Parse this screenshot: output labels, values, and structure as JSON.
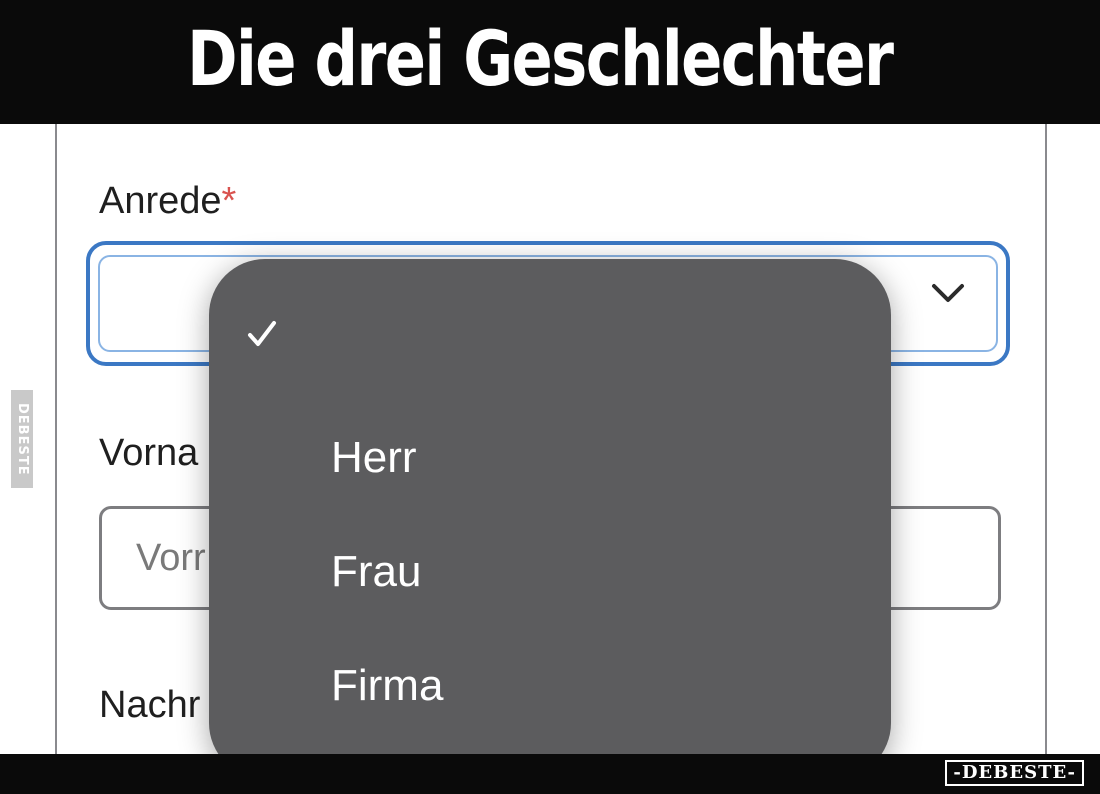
{
  "meme_title": "Die drei Geschlechter",
  "form": {
    "salutation": {
      "label": "Anrede",
      "required_marker": "*",
      "selected_value": ""
    },
    "first_name": {
      "label": "Vorna",
      "placeholder": "Vorr"
    },
    "last_name": {
      "label": "Nachr"
    }
  },
  "dropdown": {
    "options": [
      "",
      "Herr",
      "Frau",
      "Firma"
    ],
    "selected_index": 0
  },
  "watermark": {
    "side": "DEBESTE",
    "bottom": "-DEBESTE-"
  },
  "icons": {
    "select_chevron": "chevron-down-icon",
    "selected_marker": "checkmark-icon"
  },
  "colors": {
    "focus_border": "#3b78c4",
    "required": "#d9534f",
    "dropdown_bg": "#5c5c5e"
  }
}
